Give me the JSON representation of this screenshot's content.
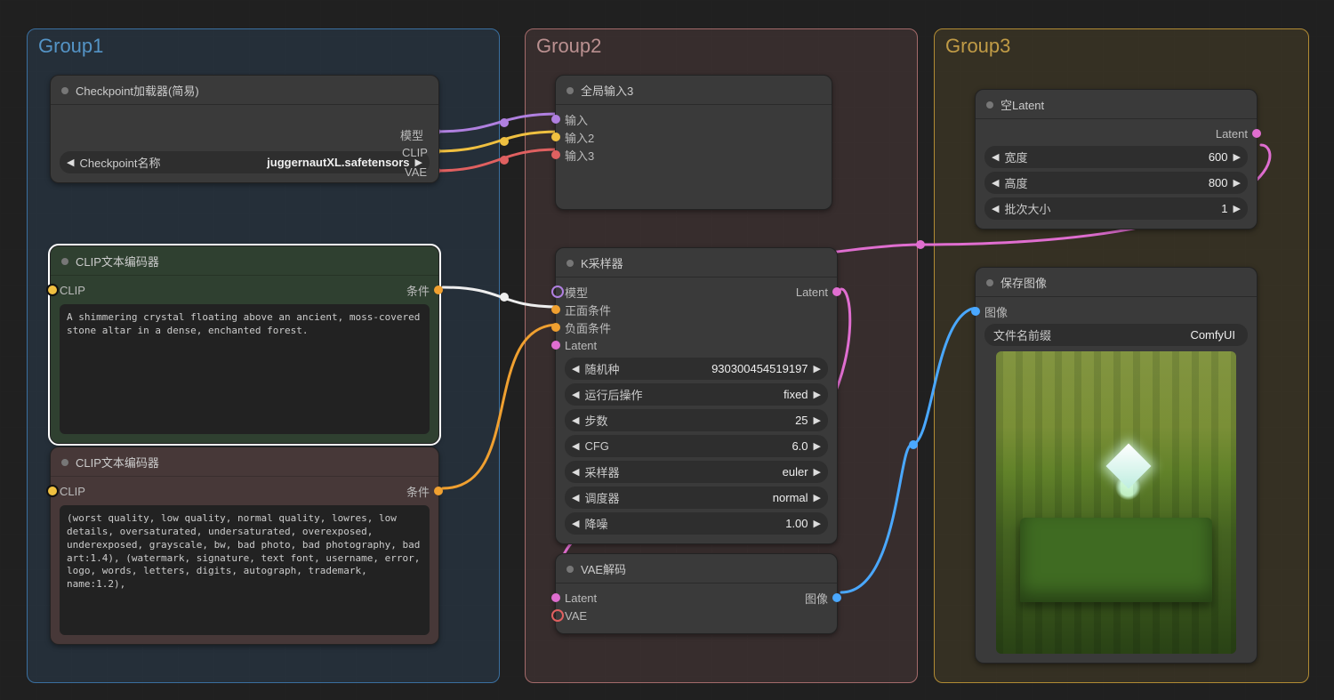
{
  "groups": {
    "g1": {
      "title": "Group1",
      "color": "#3a6f9f"
    },
    "g2": {
      "title": "Group2",
      "color": "#a36a6a"
    },
    "g3": {
      "title": "Group3",
      "color": "#b18b34"
    }
  },
  "checkpoint": {
    "title": "Checkpoint加载器(简易)",
    "out_model": "模型",
    "out_clip": "CLIP",
    "out_vae": "VAE",
    "field_name": "Checkpoint名称",
    "field_value": "juggernautXL.safetensors"
  },
  "clip_pos": {
    "title": "CLIP文本编码器",
    "in_clip": "CLIP",
    "out_cond": "条件",
    "text": "A shimmering crystal floating above an ancient, moss-covered stone altar in a dense, enchanted forest."
  },
  "clip_neg": {
    "title": "CLIP文本编码器",
    "in_clip": "CLIP",
    "out_cond": "条件",
    "text": "(worst quality, low quality, normal quality, lowres, low details, oversaturated, undersaturated, overexposed, underexposed, grayscale, bw, bad photo, bad photography, bad art:1.4), (watermark, signature, text font, username, error, logo, words, letters, digits, autograph, trademark, name:1.2),"
  },
  "global_in": {
    "title": "全局输入3",
    "in1": "输入",
    "in2": "输入2",
    "in3": "输入3"
  },
  "ksampler": {
    "title": "K采样器",
    "in_model": "模型",
    "in_pos": "正面条件",
    "in_neg": "负面条件",
    "in_latent": "Latent",
    "out_latent": "Latent",
    "fields": {
      "seed": {
        "name": "随机种",
        "value": "930300454519197"
      },
      "after": {
        "name": "运行后操作",
        "value": "fixed"
      },
      "steps": {
        "name": "步数",
        "value": "25"
      },
      "cfg": {
        "name": "CFG",
        "value": "6.0"
      },
      "sampler": {
        "name": "采样器",
        "value": "euler"
      },
      "scheduler": {
        "name": "调度器",
        "value": "normal"
      },
      "denoise": {
        "name": "降噪",
        "value": "1.00"
      }
    }
  },
  "vae_decode": {
    "title": "VAE解码",
    "in_latent": "Latent",
    "in_vae": "VAE",
    "out_image": "图像"
  },
  "empty_latent": {
    "title": "空Latent",
    "out_latent": "Latent",
    "fields": {
      "width": {
        "name": "宽度",
        "value": "600"
      },
      "height": {
        "name": "高度",
        "value": "800"
      },
      "batch": {
        "name": "批次大小",
        "value": "1"
      }
    }
  },
  "save": {
    "title": "保存图像",
    "in_image": "图像",
    "prefix_name": "文件名前缀",
    "prefix_value": "ComfyUI"
  },
  "arrows": {
    "left": "◀",
    "right": "▶"
  }
}
